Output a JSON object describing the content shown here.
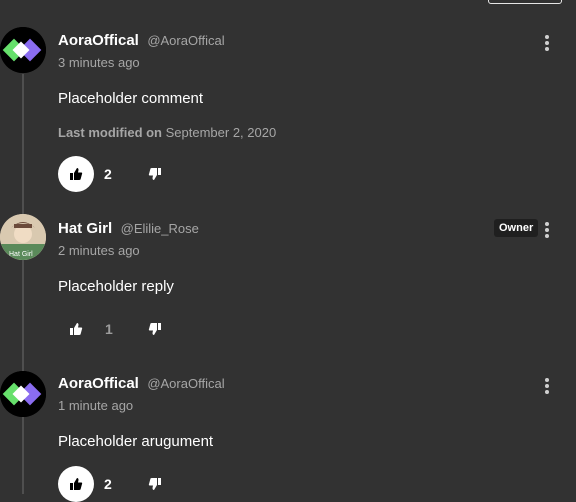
{
  "comments": [
    {
      "author": "AoraOffical",
      "handle": "@AoraOffical",
      "time": "3 minutes ago",
      "body": "Placeholder comment",
      "modified_label": "Last modified on",
      "modified_date": "September 2, 2020",
      "likes": "2",
      "like_active": true
    },
    {
      "author": "Hat Girl",
      "handle": "@Elilie_Rose",
      "time": "2 minutes ago",
      "badge": "Owner",
      "avatar_text": "Hat Girl",
      "body": "Placeholder reply",
      "likes": "1",
      "like_active": false
    },
    {
      "author": "AoraOffical",
      "handle": "@AoraOffical",
      "time": "1 minute ago",
      "body": "Placeholder arugument",
      "likes": "2",
      "like_active": true
    }
  ],
  "colors": {
    "background": "#323232",
    "text_muted": "#a6a6a6",
    "logo_green": "#66e06b",
    "logo_purple": "#8a6cf0"
  },
  "icons": {
    "like": "thumbs-up-icon",
    "dislike": "thumbs-down-icon",
    "menu": "kebab-menu-icon"
  }
}
